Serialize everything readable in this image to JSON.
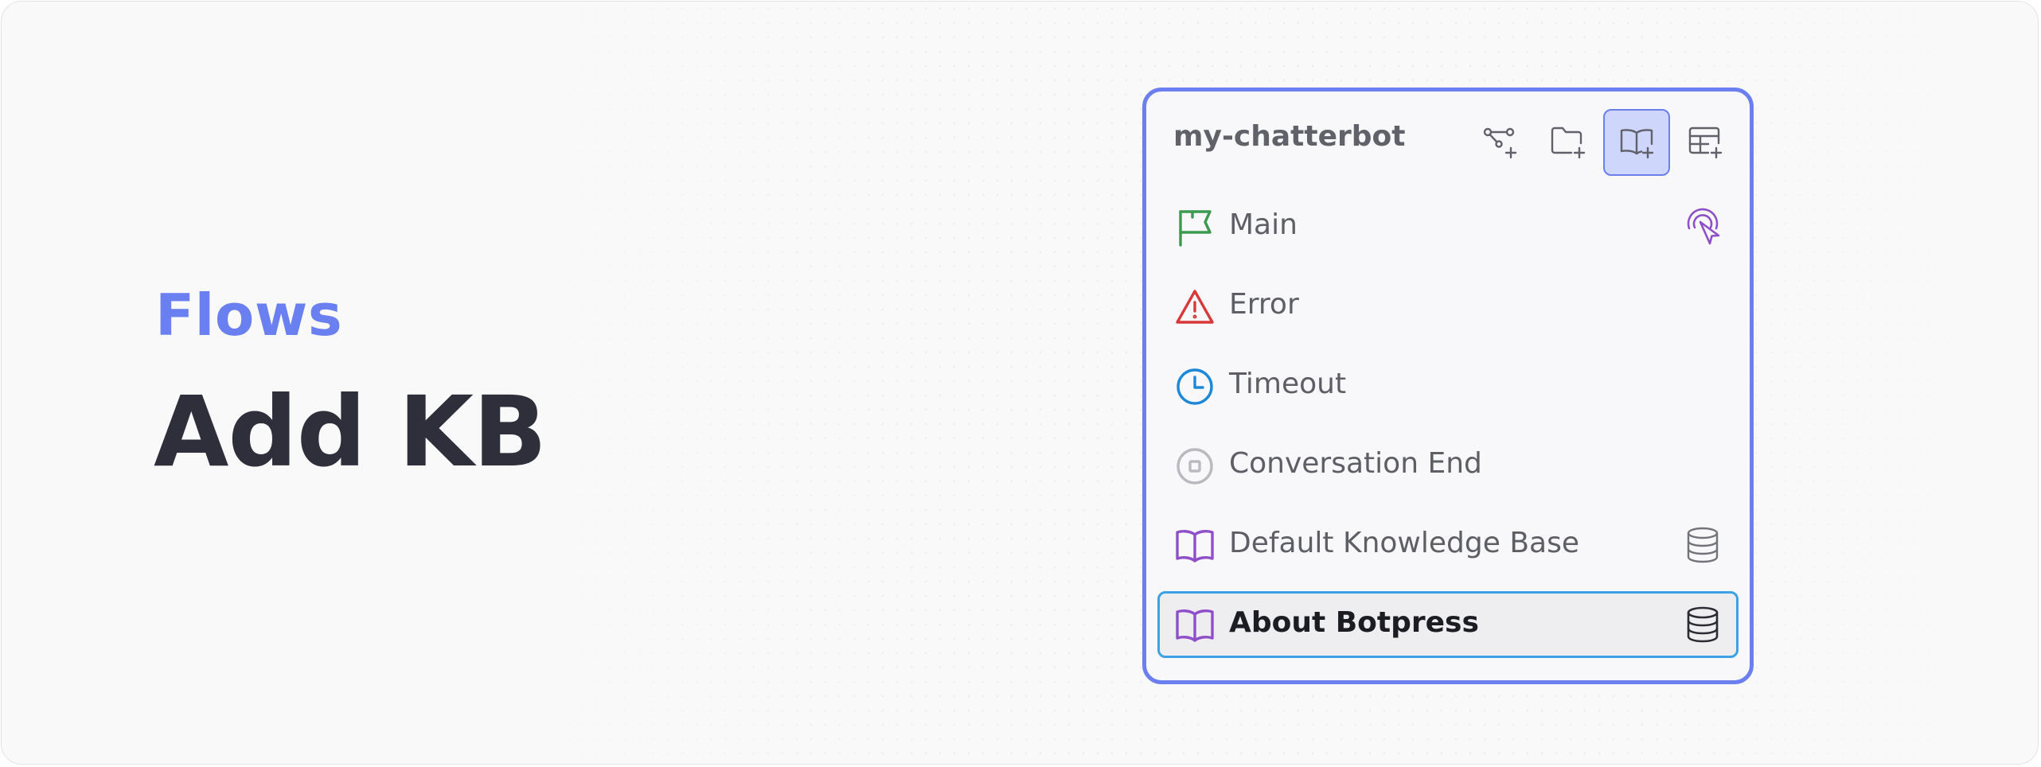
{
  "hero": {
    "eyebrow": "Flows",
    "title": "Add KB"
  },
  "panel": {
    "bot_name": "my-chatterbot",
    "toolbar": [
      {
        "icon": "add-workflow-icon",
        "active": false
      },
      {
        "icon": "add-folder-icon",
        "active": false
      },
      {
        "icon": "add-knowledge-base-icon",
        "active": true
      },
      {
        "icon": "add-table-icon",
        "active": false
      }
    ],
    "items": [
      {
        "label": "Main",
        "icon": "flag-icon",
        "icon_color": "#3a9a4e",
        "trailing_icon": "pointer-click-icon",
        "trailing_color": "#8e4fc9",
        "selected": false
      },
      {
        "label": "Error",
        "icon": "warning-triangle-icon",
        "icon_color": "#d9383a",
        "selected": false
      },
      {
        "label": "Timeout",
        "icon": "clock-icon",
        "icon_color": "#1e88d8",
        "selected": false
      },
      {
        "label": "Conversation End",
        "icon": "stop-circle-icon",
        "icon_color": "#b9b9c0",
        "selected": false
      },
      {
        "label": "Default Knowledge Base",
        "icon": "book-icon",
        "icon_color": "#8e4fc9",
        "trailing_icon": "database-icon",
        "trailing_color": "#73747b",
        "selected": false
      },
      {
        "label": "About Botpress",
        "icon": "book-icon",
        "icon_color": "#8e4fc9",
        "trailing_icon": "database-icon",
        "trailing_color": "#2b2c33",
        "selected": true
      }
    ]
  },
  "colors": {
    "accent": "#6b7ff0",
    "selection_border": "#3da1e6",
    "headline": "#2e2f3a"
  }
}
